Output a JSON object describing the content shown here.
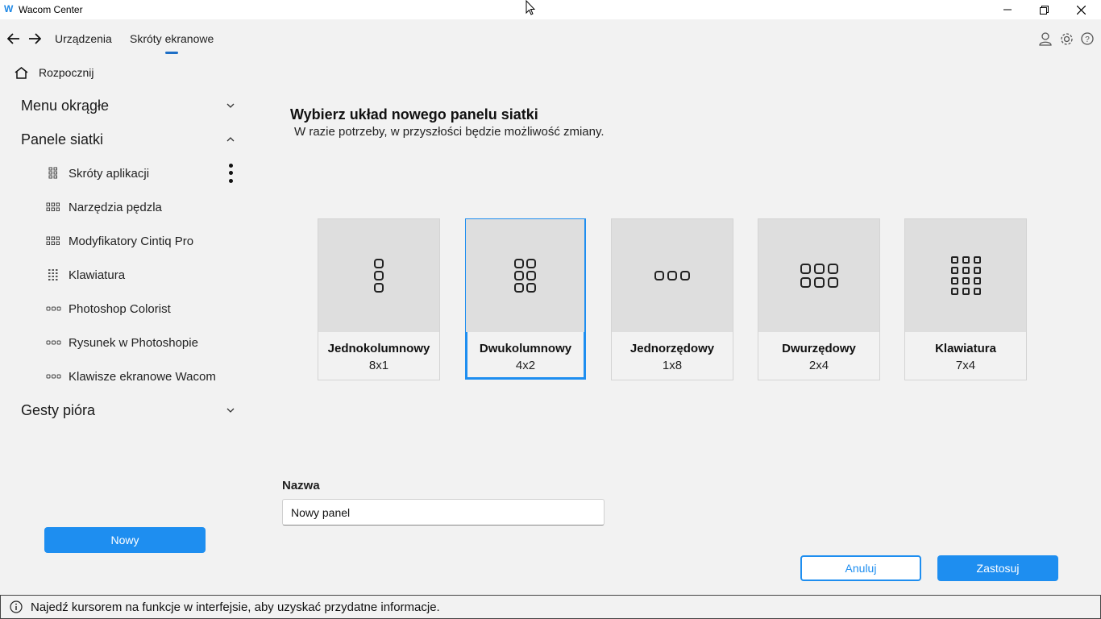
{
  "window": {
    "logo": "W",
    "title": "Wacom Center"
  },
  "nav": {
    "tabs": [
      "Urządzenia",
      "Skróty ekranowe"
    ],
    "active_tab": "Skróty ekranowe"
  },
  "sidebar": {
    "home_label": "Rozpocznij",
    "sections": {
      "radial_menu": "Menu okrągłe",
      "grid_panels": "Panele siatki",
      "pen_gestures": "Gesty pióra"
    },
    "items": [
      {
        "label": "Skróty aplikacji",
        "icon": "grid-2x4-icon"
      },
      {
        "label": "Narzędzia pędzla",
        "icon": "grid-2x4-icon"
      },
      {
        "label": "Modyfikatory Cintiq Pro",
        "icon": "grid-2x4-icon"
      },
      {
        "label": "Klawiatura",
        "icon": "grid-7x4-icon"
      },
      {
        "label": "Photoshop Colorist",
        "icon": "grid-1x8-icon"
      },
      {
        "label": "Rysunek w Photoshopie",
        "icon": "grid-1x8-icon"
      },
      {
        "label": "Klawisze ekranowe Wacom",
        "icon": "grid-1x8-icon"
      }
    ],
    "new_button": "Nowy"
  },
  "main": {
    "title": "Wybierz układ nowego panelu siatki",
    "subtitle": "W razie potrzeby, w przyszłości będzie możliwość zmiany.",
    "layouts": [
      {
        "name": "Jednokolumnowy",
        "dims": "8x1",
        "selected": false
      },
      {
        "name": "Dwukolumnowy",
        "dims": "4x2",
        "selected": true
      },
      {
        "name": "Jednorzędowy",
        "dims": "1x8",
        "selected": false
      },
      {
        "name": "Dwurzędowy",
        "dims": "2x4",
        "selected": false
      },
      {
        "name": "Klawiatura",
        "dims": "7x4",
        "selected": false
      }
    ],
    "name_label": "Nazwa",
    "name_value": "Nowy panel",
    "cancel_button": "Anuluj",
    "apply_button": "Zastosuj"
  },
  "status": {
    "text": "Najedź kursorem na funkcje w interfejsie, aby uzyskać przydatne informacje."
  },
  "colors": {
    "accent": "#1e8ef0",
    "background": "#f2f2f2",
    "card_preview": "#dedede"
  }
}
